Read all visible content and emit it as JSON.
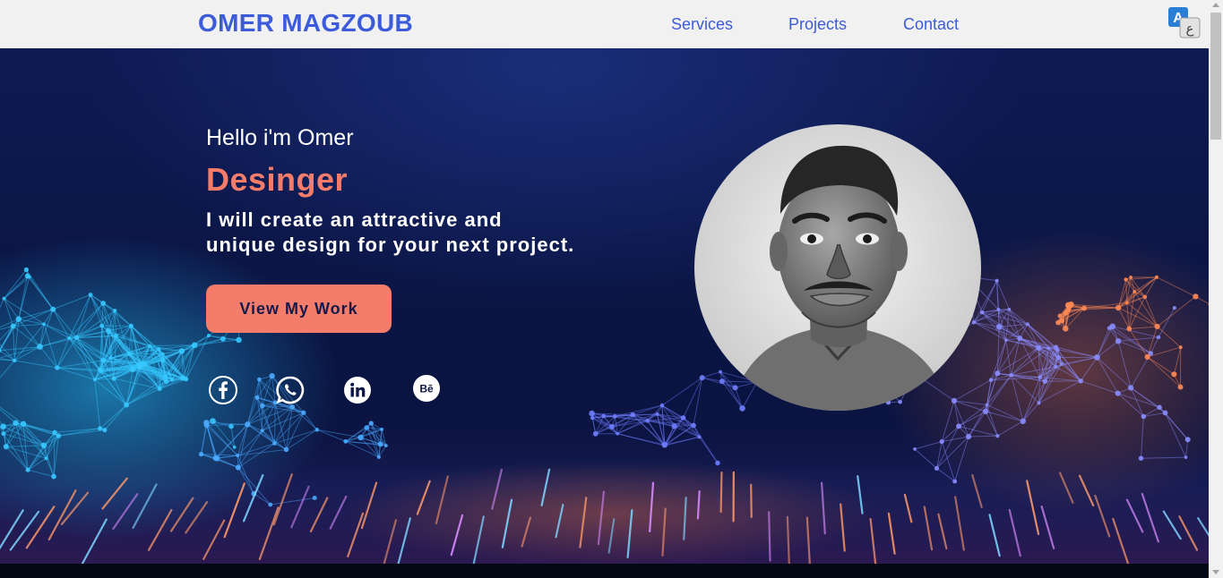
{
  "header": {
    "logo": "OMER MAGZOUB",
    "nav": [
      {
        "label": "Services"
      },
      {
        "label": "Projects"
      },
      {
        "label": "Contact"
      }
    ],
    "translate_icon": "translate-icon"
  },
  "hero": {
    "greeting": "Hello i'm Omer",
    "role": "Desinger",
    "tagline_line1": "I will create an attractive and",
    "tagline_line2": "unique design for your next project.",
    "cta_label": "View My Work",
    "social_icons": [
      "facebook-icon",
      "whatsapp-icon",
      "linkedin-icon",
      "behance-icon"
    ],
    "behance_text": "Bē"
  },
  "colors": {
    "brand": "#3b5bdb",
    "accent": "#f47c6a",
    "header_bg": "#f1f1f1",
    "hero_bg": "#0b1646"
  }
}
